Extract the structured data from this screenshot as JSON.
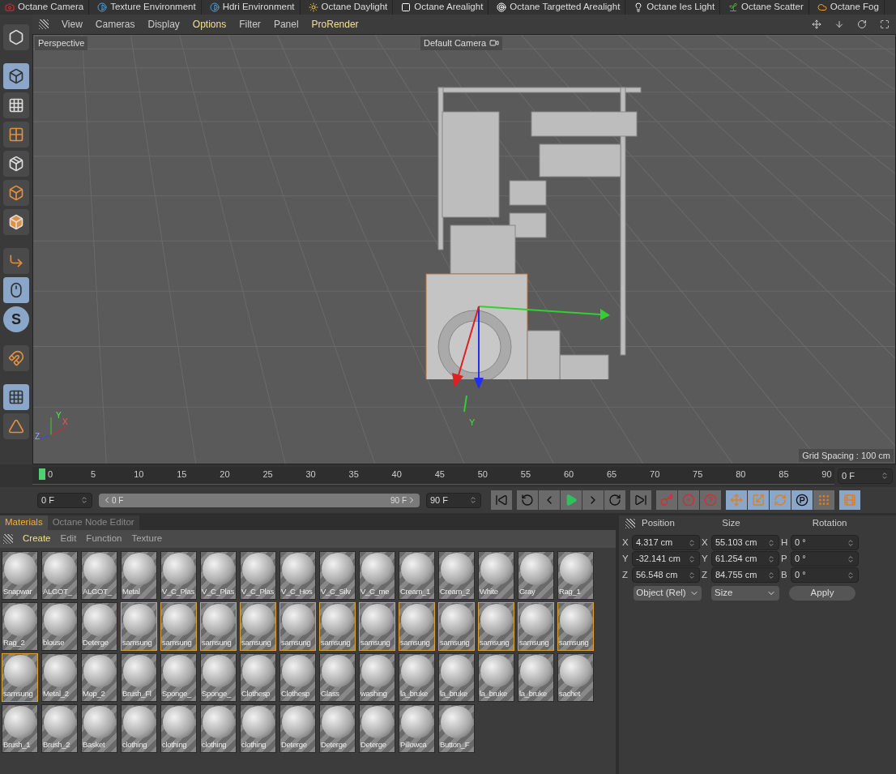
{
  "top_bar": [
    {
      "label": "Octane Camera",
      "kind": "camera"
    },
    {
      "label": "Texture Environment",
      "kind": "half"
    },
    {
      "label": "Hdri Environment",
      "kind": "half"
    },
    {
      "label": "Octane Daylight",
      "kind": "sun"
    },
    {
      "label": "Octane Arealight",
      "kind": "area"
    },
    {
      "label": "Octane Targetted Arealight",
      "kind": "target"
    },
    {
      "label": "Octane Ies Light",
      "kind": "ies"
    },
    {
      "label": "Octane Scatter",
      "kind": "scatter"
    },
    {
      "label": "Octane Fog",
      "kind": "fog"
    }
  ],
  "left_toolbar": {
    "snap_label": "S"
  },
  "viewport": {
    "menu": [
      {
        "label": "View",
        "highlighted": false
      },
      {
        "label": "Cameras",
        "highlighted": false
      },
      {
        "label": "Display",
        "highlighted": false
      },
      {
        "label": "Options",
        "highlighted": true
      },
      {
        "label": "Filter",
        "highlighted": false
      },
      {
        "label": "Panel",
        "highlighted": false
      },
      {
        "label": "ProRender",
        "highlighted": true
      }
    ],
    "view_name": "Perspective",
    "camera": "Default Camera",
    "grid_spacing": "Grid Spacing : 100 cm",
    "axis_labels": [
      "Y",
      "X",
      "Z"
    ],
    "gizmo_label": "Y"
  },
  "timeline": {
    "ticks": [
      "0",
      "5",
      "10",
      "15",
      "20",
      "25",
      "30",
      "35",
      "40",
      "45",
      "50",
      "55",
      "60",
      "65",
      "70",
      "75",
      "80",
      "85",
      "90"
    ],
    "current_frame": "0 F",
    "start": "0 F",
    "range": {
      "start": "0 F",
      "end": "90 F",
      "level": 1
    },
    "end": "90 F"
  },
  "materials": {
    "tabs": [
      {
        "label": "Materials",
        "selected": true
      },
      {
        "label": "Octane Node Editor",
        "selected": false
      }
    ],
    "menu": [
      {
        "label": "Create",
        "highlighted": true
      },
      {
        "label": "Edit",
        "highlighted": false
      },
      {
        "label": "Function",
        "highlighted": false
      },
      {
        "label": "Texture",
        "highlighted": false
      }
    ],
    "items": [
      {
        "label": "Snapwar",
        "selected": false
      },
      {
        "label": "ALGOT_",
        "selected": false
      },
      {
        "label": "ALGOT_",
        "selected": false
      },
      {
        "label": "Metal",
        "selected": false
      },
      {
        "label": "V_C_Plas",
        "selected": false
      },
      {
        "label": "V_C_Plas",
        "selected": false
      },
      {
        "label": "V_C_Plas",
        "selected": false
      },
      {
        "label": "V_C_Hos",
        "selected": false
      },
      {
        "label": "V_C_Silv",
        "selected": false
      },
      {
        "label": "V_C_me",
        "selected": false
      },
      {
        "label": "Cream_1",
        "selected": false
      },
      {
        "label": "Cream_2",
        "selected": false
      },
      {
        "label": "White",
        "selected": false
      },
      {
        "label": "Gray",
        "selected": false
      },
      {
        "label": "Rag_1",
        "selected": false
      },
      {
        "label": "Rag_2",
        "selected": false
      },
      {
        "label": "blouse",
        "selected": false
      },
      {
        "label": "Deterge",
        "selected": false
      },
      {
        "label": "samsung",
        "selected": true
      },
      {
        "label": "samsung",
        "selected": true
      },
      {
        "label": "samsung",
        "selected": true
      },
      {
        "label": "samsung",
        "selected": true
      },
      {
        "label": "samsung",
        "selected": true
      },
      {
        "label": "samsung",
        "selected": true
      },
      {
        "label": "samsung",
        "selected": true
      },
      {
        "label": "samsung",
        "selected": true
      },
      {
        "label": "samsung",
        "selected": true
      },
      {
        "label": "samsung",
        "selected": true
      },
      {
        "label": "samsung",
        "selected": true
      },
      {
        "label": "samsung",
        "selected": true
      },
      {
        "label": "samsung",
        "selected": true
      },
      {
        "label": "Metal_2",
        "selected": false
      },
      {
        "label": "Mop_2",
        "selected": false
      },
      {
        "label": "Brush_Fl",
        "selected": false
      },
      {
        "label": "Sponge_",
        "selected": false
      },
      {
        "label": "Sponge_",
        "selected": false
      },
      {
        "label": "Clothesp",
        "selected": false
      },
      {
        "label": "Clothesp",
        "selected": false
      },
      {
        "label": "Glass",
        "selected": false
      },
      {
        "label": "washing",
        "selected": false
      },
      {
        "label": "la_bruke",
        "selected": false
      },
      {
        "label": "la_bruke",
        "selected": false
      },
      {
        "label": "la_bruke",
        "selected": false
      },
      {
        "label": "la_bruke",
        "selected": false
      },
      {
        "label": "sachet",
        "selected": false
      },
      {
        "label": "Brush_1",
        "selected": false
      },
      {
        "label": "Brush_2",
        "selected": false
      },
      {
        "label": "Basket",
        "selected": false
      },
      {
        "label": "clothing",
        "selected": false
      },
      {
        "label": "clothing",
        "selected": false
      },
      {
        "label": "clothing",
        "selected": false
      },
      {
        "label": "clothing",
        "selected": false
      },
      {
        "label": "Deterge",
        "selected": false
      },
      {
        "label": "Deterge",
        "selected": false
      },
      {
        "label": "Deterge",
        "selected": false
      },
      {
        "label": "Pillowca",
        "selected": false
      },
      {
        "label": "Button_F",
        "selected": false
      }
    ]
  },
  "coordinates": {
    "headers": [
      "Position",
      "Size",
      "Rotation"
    ],
    "rows": [
      {
        "pos_axis": "X",
        "pos": "4.317 cm",
        "size_axis": "X",
        "size": "55.103 cm",
        "rot_axis": "H",
        "rot": "0 °"
      },
      {
        "pos_axis": "Y",
        "pos": "-32.141 cm",
        "size_axis": "Y",
        "size": "61.254 cm",
        "rot_axis": "P",
        "rot": "0 °"
      },
      {
        "pos_axis": "Z",
        "pos": "56.548 cm",
        "size_axis": "Z",
        "size": "84.755 cm",
        "rot_axis": "B",
        "rot": "0 °"
      }
    ],
    "mode": "Object (Rel)",
    "size_mode": "Size",
    "apply": "Apply"
  }
}
